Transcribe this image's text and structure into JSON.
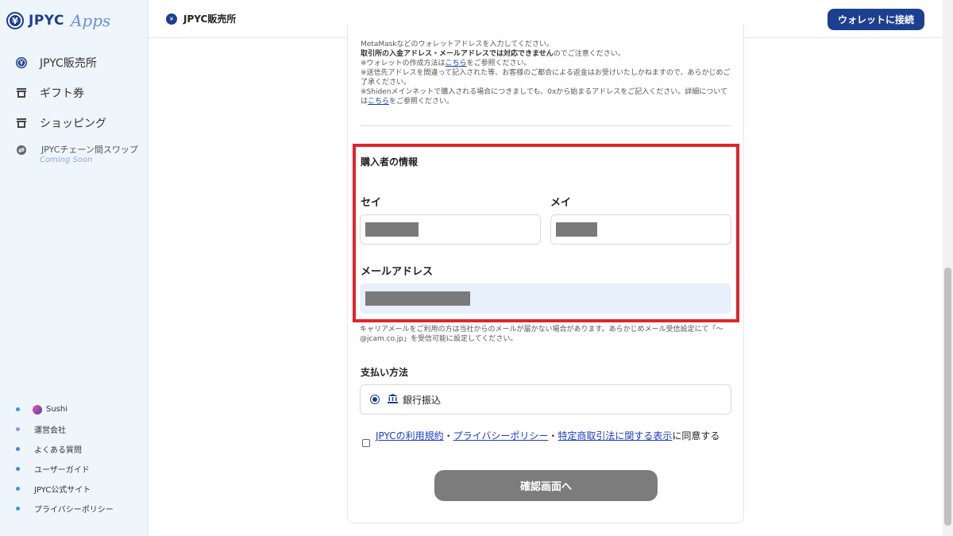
{
  "app": {
    "logo_text": "JPYC",
    "logo_apps": "Apps",
    "logo_mark": "¥"
  },
  "sidebar": {
    "items": [
      {
        "label": "JPYC販売所",
        "icon": "jpyc-coin-icon"
      },
      {
        "label": "ギフト券",
        "icon": "store-icon"
      },
      {
        "label": "ショッピング",
        "icon": "store-icon"
      },
      {
        "label": "JPYCチェーン間スワップ",
        "icon": "swap-icon",
        "badge": "Coming Soon"
      }
    ],
    "links": [
      {
        "label": "Sushi",
        "dot_color": "#2aa4d8"
      },
      {
        "label": "運営会社",
        "dot_color": "#a98be0"
      },
      {
        "label": "よくある質問",
        "dot_color": "#4a86d8"
      },
      {
        "label": "ユーザーガイド",
        "dot_color": "#4a86d8"
      },
      {
        "label": "JPYC公式サイト",
        "dot_color": "#2aa4d8"
      },
      {
        "label": "プライバシーポリシー",
        "dot_color": "#2aa4d8"
      }
    ]
  },
  "header": {
    "title": "JPYC販売所",
    "connect_button": "ウォレットに接続"
  },
  "notes": {
    "line1": "MetaMaskなどのウォレットアドレスを入力してください。",
    "line2_bold": "取引所の入金アドレス・メールアドレスでは対応できません",
    "line2_rest": "のでご注意ください。",
    "line3_pre": "※ウォレットの作成方法は",
    "line3_link": "こちら",
    "line3_post": "をご参照ください。",
    "line4": "※送信先アドレスを間違って記入された等、お客様のご都合による返金はお受けいたしかねますので、あらかじめご了承ください。",
    "line5_pre": "※Shidenメインネットで購入される場合につきましても、0xから始まるアドレスをご記入ください。詳細については",
    "line5_link": "こちら",
    "line5_post": "をご参照ください。"
  },
  "buyer": {
    "section_title": "購入者の情報",
    "sei_label": "セイ",
    "mei_label": "メイ",
    "email_label": "メールアドレス"
  },
  "carrier_note": "キャリアメールをご利用の方は当社からのメールが届かない場合があります。あらかじめメール受信設定にて「〜@jcam.co.jp」を受信可能に設定してください。",
  "payment": {
    "section_title": "支払い方法",
    "option_label": "銀行振込",
    "option_icon": "bank-icon"
  },
  "agreement": {
    "link1": "JPYCの利用規約",
    "sep": "・",
    "link2": "プライバシーポリシー",
    "link3": "特定商取引法に関する表示",
    "suffix": "に同意する"
  },
  "confirm_button": "確認画面へ",
  "colors": {
    "brand": "#1d3f8f",
    "highlight_border": "#e0242c",
    "sidebar_bg": "#eef6fc",
    "disabled_button": "#7c7c7c"
  }
}
